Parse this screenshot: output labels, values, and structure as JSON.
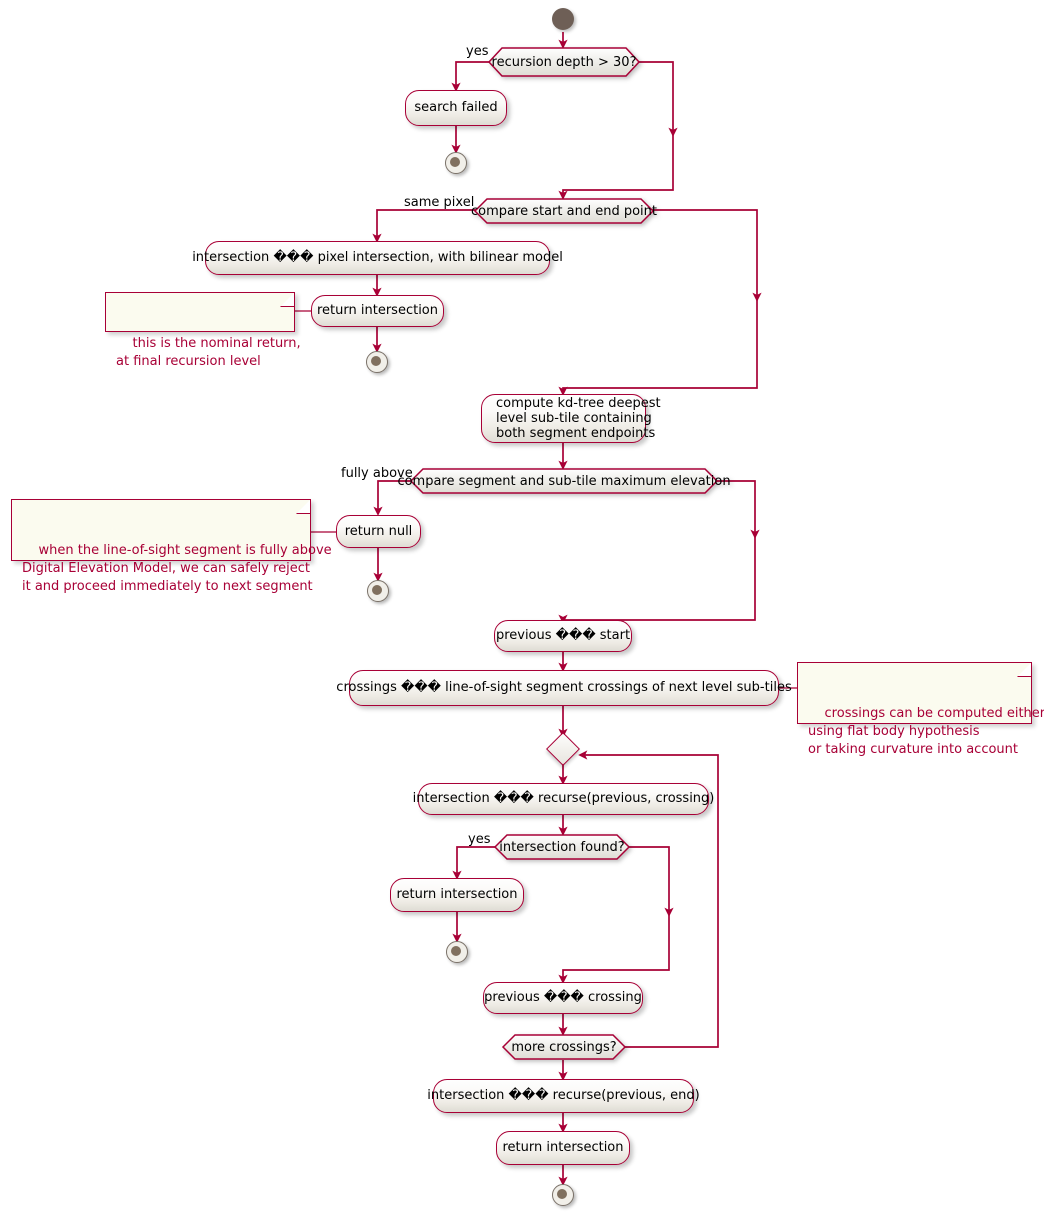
{
  "diagram": {
    "type": "uml-activity-diagram",
    "title": "",
    "colors": {
      "line": "#A80036",
      "node_border": "#A80036",
      "node_fill_top": "#FEFEFE",
      "node_fill_bottom": "#DEDCD4",
      "note_fill": "#FBFBEF",
      "note_text": "#A80036",
      "start_node": "#6E5F56",
      "end_node_inner": "#80705F",
      "background": "#FFFFFF",
      "text": "#000000"
    },
    "unreadable_glyph": "\u0000\u0000\u0000",
    "nodes": [
      {
        "id": "start",
        "kind": "start",
        "label": ""
      },
      {
        "id": "d1",
        "kind": "decision",
        "label": "recursion depth > 30?"
      },
      {
        "id": "a1",
        "kind": "activity",
        "label": "search failed"
      },
      {
        "id": "e1",
        "kind": "end",
        "label": ""
      },
      {
        "id": "d2",
        "kind": "decision",
        "label": "compare start and end point"
      },
      {
        "id": "a2",
        "kind": "activity",
        "label": "intersection â pixel intersection, with bilinear model"
      },
      {
        "id": "a3",
        "kind": "activity",
        "label": "return intersection"
      },
      {
        "id": "e2",
        "kind": "end",
        "label": ""
      },
      {
        "id": "a4",
        "kind": "activity-multiline",
        "label": "compute kd-tree deepest\nlevel sub-tile containing\nboth segment endpoints"
      },
      {
        "id": "d3",
        "kind": "decision",
        "label": "compare segment and sub-tile maximum elevation"
      },
      {
        "id": "a5",
        "kind": "activity",
        "label": "return null"
      },
      {
        "id": "e3",
        "kind": "end",
        "label": ""
      },
      {
        "id": "a6",
        "kind": "activity",
        "label": "previous â start"
      },
      {
        "id": "a7",
        "kind": "activity",
        "label": "crossings â line-of-sight segment crossings of next level sub-tiles"
      },
      {
        "id": "m1",
        "kind": "merge",
        "label": ""
      },
      {
        "id": "a8",
        "kind": "activity",
        "label": "intersection â recurse(previous, crossing)"
      },
      {
        "id": "d4",
        "kind": "decision",
        "label": "intersection found?"
      },
      {
        "id": "a9",
        "kind": "activity",
        "label": "return intersection"
      },
      {
        "id": "e4",
        "kind": "end",
        "label": ""
      },
      {
        "id": "a10",
        "kind": "activity",
        "label": "previous â crossing"
      },
      {
        "id": "d5",
        "kind": "decision",
        "label": "more crossings?"
      },
      {
        "id": "a11",
        "kind": "activity",
        "label": "intersection â recurse(previous, end)"
      },
      {
        "id": "a12",
        "kind": "activity",
        "label": "return intersection"
      },
      {
        "id": "e5",
        "kind": "end",
        "label": ""
      }
    ],
    "labels": {
      "branch_yes_1": "yes",
      "branch_same_pixel": "same pixel",
      "branch_fully_above": "fully above",
      "branch_yes_2": "yes"
    },
    "texts": {
      "d1": "recursion depth > 30?",
      "a1": "search failed",
      "d2": "compare start and end point",
      "a2_pre": "intersection ",
      "a2_post": " pixel intersection, with bilinear model",
      "a3": "return intersection",
      "a4": "compute kd-tree deepest\nlevel sub-tile containing\nboth segment endpoints",
      "d3": "compare segment and sub-tile maximum elevation",
      "a5": "return null",
      "a6_pre": "previous ",
      "a6_post": " start",
      "a7_pre": "crossings ",
      "a7_post": " line-of-sight segment crossings of next level sub-tiles",
      "a8_pre": "intersection ",
      "a8_post": " recurse(previous, crossing)",
      "d4": "intersection found?",
      "a9": "return intersection",
      "a10_pre": "previous ",
      "a10_post": " crossing",
      "d5": "more crossings?",
      "a11_pre": "intersection ",
      "a11_post": " recurse(previous, end)",
      "a12": "return intersection",
      "glyph": "���"
    },
    "notes": [
      {
        "id": "note1",
        "text": "this is the nominal return,\nat final recursion level",
        "attached_to": "return intersection"
      },
      {
        "id": "note2",
        "text": "when the line-of-sight segment is fully above\nDigital Elevation Model, we can safely reject\nit and proceed immediately to next segment",
        "attached_to": "return null"
      },
      {
        "id": "note3",
        "text": "crossings can be computed either\nusing flat body hypothesis\nor taking curvature into account",
        "attached_to": "crossings assignment"
      }
    ]
  }
}
